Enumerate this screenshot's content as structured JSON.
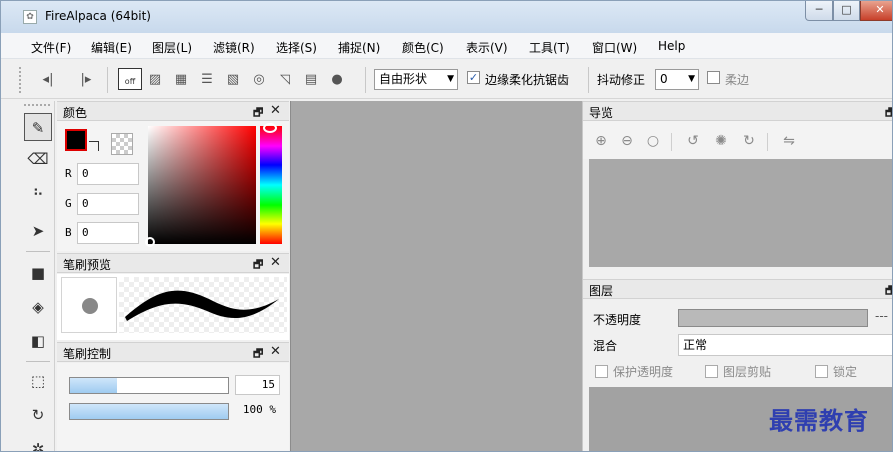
{
  "window": {
    "title": "FireAlpaca (64bit)",
    "minimize_glyph": "─",
    "maximize_glyph": "□",
    "close_glyph": "✕"
  },
  "menubar": [
    "文件(F)",
    "编辑(E)",
    "图层(L)",
    "滤镜(R)",
    "选择(S)",
    "捕捉(N)",
    "颜色(C)",
    "表示(V)",
    "工具(T)",
    "窗口(W)",
    "Help"
  ],
  "toolbar": {
    "snap_off_label": "off",
    "shape_select": "自由形状",
    "antialias_checked": true,
    "antialias_label": "边缘柔化抗锯齿",
    "correction_label": "抖动修正",
    "correction_value": "0",
    "soft_edge_checked": false,
    "soft_edge_label": "柔边",
    "icons": [
      "prev-brush-icon",
      "next-brush-icon",
      "snap-off-icon",
      "parallel-snap-icon",
      "grid-snap-icon",
      "radial-line-snap-icon",
      "vanishing-snap-icon",
      "concentric-snap-icon",
      "curve-snap-icon",
      "perspective-snap-icon",
      "dot-icon"
    ]
  },
  "tools": [
    "pen-icon",
    "eraser-icon",
    "dot-pen-icon",
    "move-icon",
    "fill-rect-icon",
    "bucket-icon",
    "gradient-icon",
    "select-icon",
    "lasso-icon",
    "magic-wand-icon"
  ],
  "color_panel": {
    "title": "颜色",
    "float_glyph": "🗗",
    "close_glyph": "✕",
    "r_label": "R",
    "r_value": "0",
    "g_label": "G",
    "g_value": "0",
    "b_label": "B",
    "b_value": "0",
    "foreground_color": "#000000",
    "hue_top": "#ff0000"
  },
  "brush_preview_panel": {
    "title": "笔刷预览"
  },
  "brush_control_panel": {
    "title": "笔刷控制",
    "size_value": "15",
    "size_fraction": 0.3,
    "opacity_value": "100 %",
    "opacity_fraction": 1.0
  },
  "navigator_panel": {
    "title": "导览",
    "icons": [
      "zoom-in-icon",
      "zoom-out-icon",
      "zoom-fit-icon",
      "rotate-left-icon",
      "rotate-reset-icon",
      "rotate-right-icon",
      "flip-horizontal-icon"
    ]
  },
  "layer_panel": {
    "title": "图层",
    "opacity_label": "不透明度",
    "opacity_dash": "---",
    "blend_label": "混合",
    "blend_value": "正常",
    "protect_alpha_label": "保护透明度",
    "clipping_label": "图层剪贴",
    "lock_label": "锁定"
  },
  "watermark": "最需教育"
}
